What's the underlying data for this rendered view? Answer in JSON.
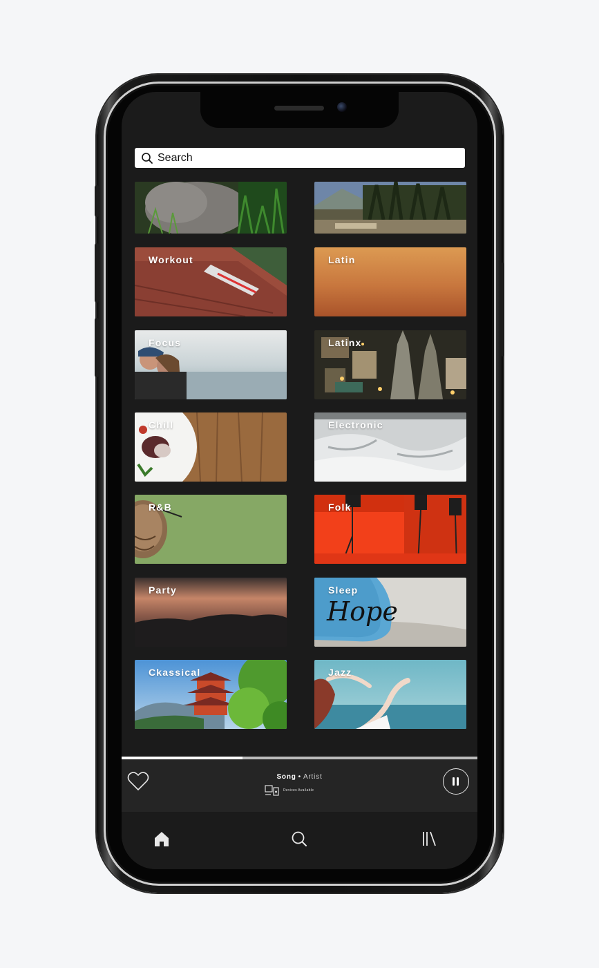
{
  "search": {
    "label": "Search",
    "icon": "search-icon"
  },
  "tiles": [
    {
      "title": ""
    },
    {
      "title": ""
    },
    {
      "title": "Workout"
    },
    {
      "title": "Latin"
    },
    {
      "title": "Focus"
    },
    {
      "title": "Latinx"
    },
    {
      "title": "Chill"
    },
    {
      "title": "Electronic"
    },
    {
      "title": "R&B"
    },
    {
      "title": "Folk"
    },
    {
      "title": "Party"
    },
    {
      "title": "Sleep"
    },
    {
      "title": "Ckassical"
    },
    {
      "title": "Jazz"
    }
  ],
  "player": {
    "song": "Song",
    "separator": "•",
    "artist": "Artist",
    "devices_label": "Devices Available",
    "progress": 0.34,
    "heart_icon": "heart-icon",
    "pause_icon": "pause-icon",
    "devices_icon": "devices-icon"
  },
  "tabbar": {
    "items": [
      {
        "icon": "home-icon"
      },
      {
        "icon": "search-icon"
      },
      {
        "icon": "library-icon"
      }
    ]
  },
  "colors": {
    "screen_bg": "#1b1b1b",
    "player_bg": "#252525",
    "latin_gradient_top": "#dc9a52",
    "latin_gradient_bottom": "#b35a2c",
    "folk_red": "#f2401a"
  }
}
